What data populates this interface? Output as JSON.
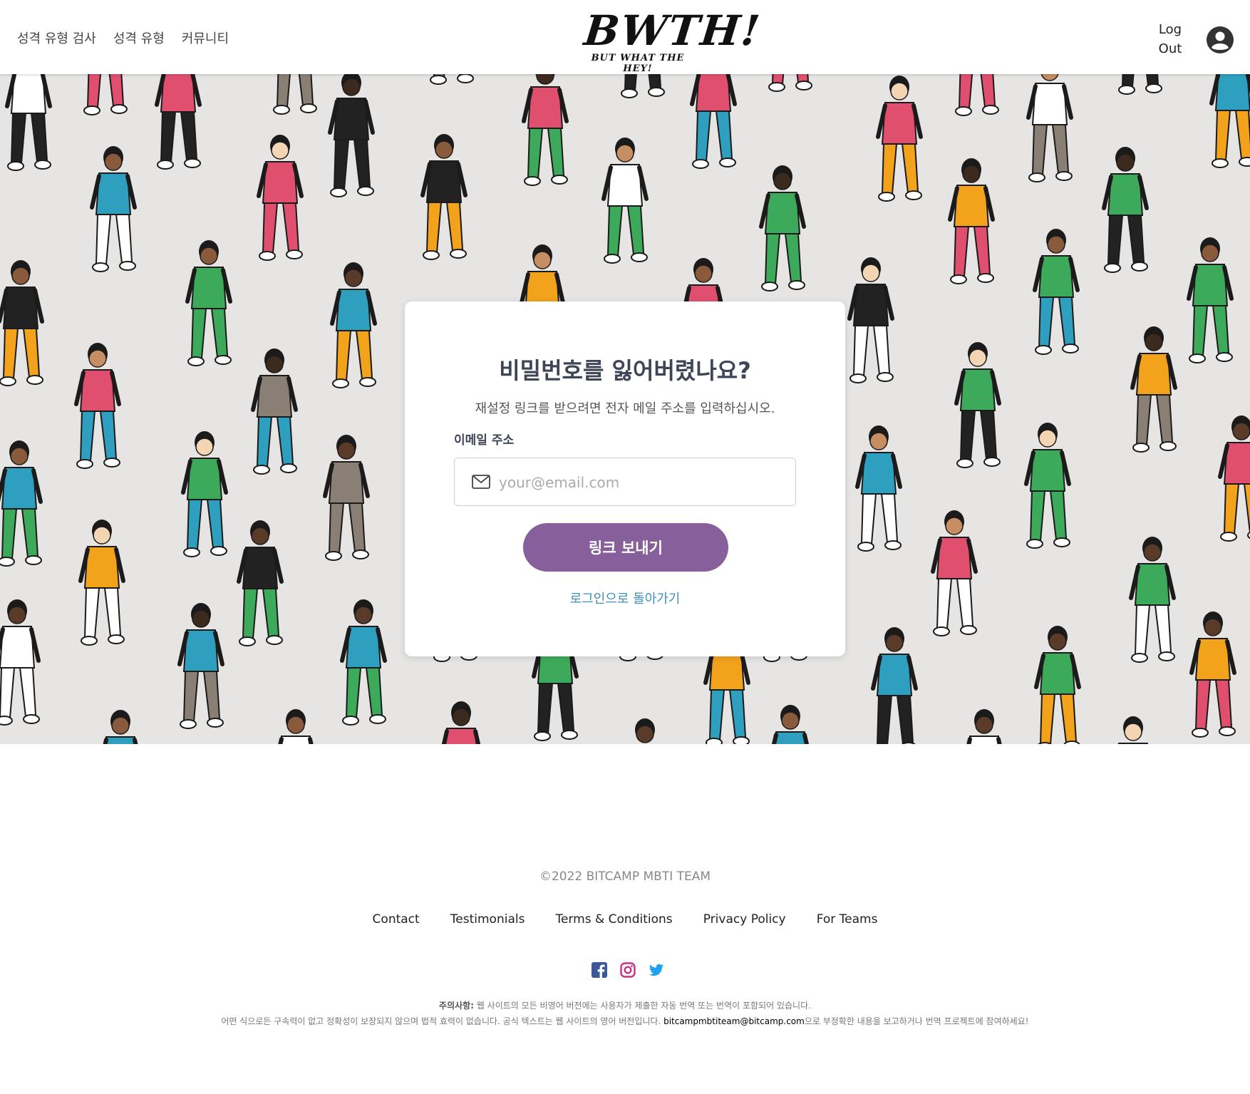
{
  "header": {
    "nav": [
      "성격 유형 검사",
      "성격 유형",
      "커뮤니티"
    ],
    "logo_main": "BWTH!",
    "logo_sub": "BUT WHAT THE HEY!",
    "logout_line1": "Log",
    "logout_line2": "Out"
  },
  "form": {
    "title": "비밀번호를 잃어버렸나요?",
    "subtitle": "재설정 링크를 받으려면 전자 메일 주소를 입력하십시오.",
    "email_label": "이메일 주소",
    "email_placeholder": "your@email.com",
    "email_value": "",
    "submit_label": "링크 보내기",
    "back_link": "로그인으로 돌아가기"
  },
  "footer": {
    "copyright": "©2022 BITCAMP MBTI TEAM",
    "links": [
      "Contact",
      "Testimonials",
      "Terms & Conditions",
      "Privacy Policy",
      "For Teams"
    ],
    "social_icons": [
      "facebook-icon",
      "instagram-icon",
      "twitter-icon"
    ],
    "disclaimer_bold": "주의사항:",
    "disclaimer_line1": " 웹 사이트의 모든 비영어 버전에는 사용자가 제출한 자동 번역 또는 번역이 포함되어 있습니다.",
    "disclaimer_line2_pre": "어떤 식으로든 구속력이 없고 정확성이 보장되지 않으며 법적 효력이 없습니다. 공식 텍스트는 웹 사이트의 영어 버전입니다. ",
    "disclaimer_email": "bitcampmbtiteam@bitcamp.com",
    "disclaimer_line2_post": "으로 부정확한 내용을 보고하거나 번역 프로젝트에 참여하세요!"
  },
  "colors": {
    "accent": "#87609b",
    "link": "#3f8fb5",
    "hero_bg": "#e6e5e3",
    "facebook": "#3b5998",
    "instagram": "#c13584",
    "twitter": "#1da1f2"
  }
}
